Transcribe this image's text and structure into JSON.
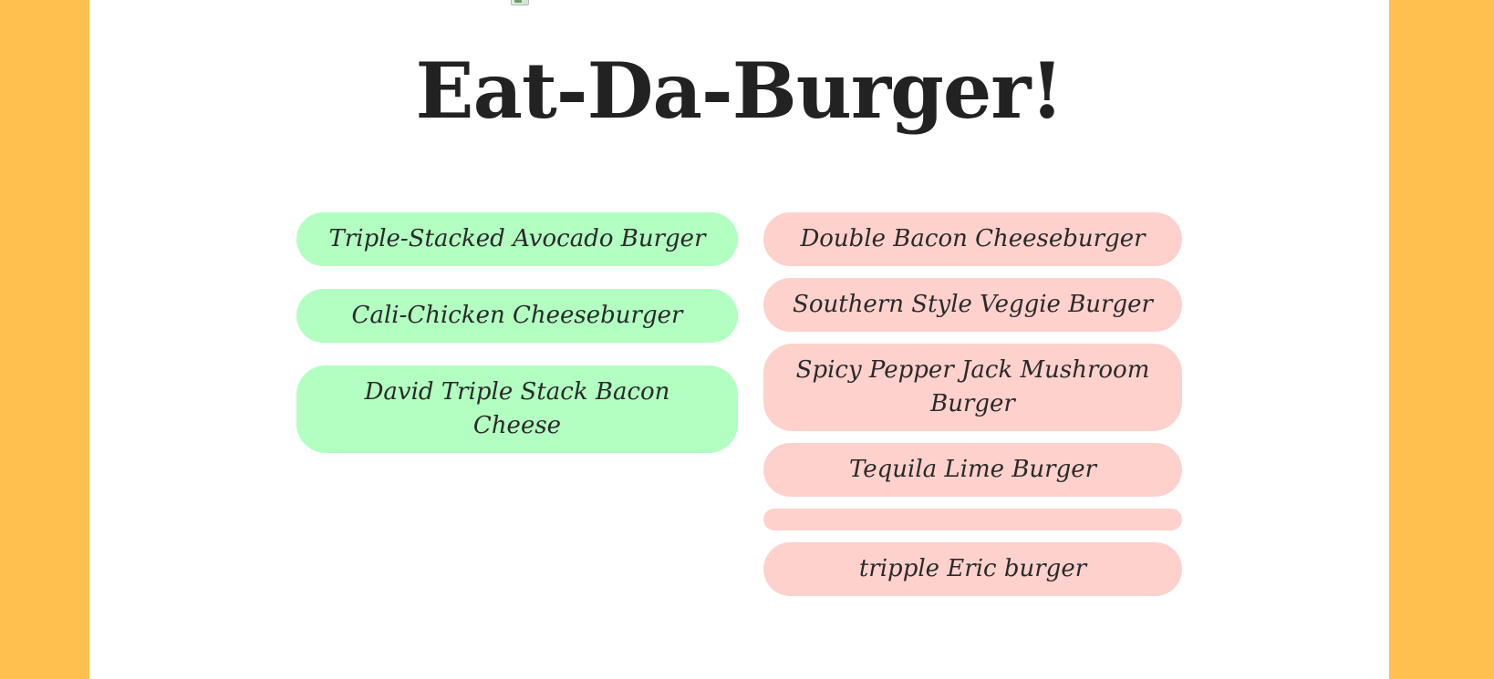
{
  "title": "Eat-Da-Burger!",
  "colors": {
    "background": "#ffc04e",
    "page": "#ffffff",
    "ready_button": "#b2ffc1",
    "devoured_button": "#ffd1cc",
    "text": "#222222"
  },
  "icons": {
    "header_image": "broken-image-icon"
  },
  "ready_burgers": [
    {
      "label": "Triple-Stacked Avocado Burger"
    },
    {
      "label": "Cali-Chicken Cheeseburger"
    },
    {
      "label": "David Triple Stack Bacon Cheese"
    }
  ],
  "devoured_burgers": [
    {
      "label": "Double Bacon Cheeseburger"
    },
    {
      "label": "Southern Style Veggie Burger"
    },
    {
      "label": "Spicy Pepper Jack Mushroom Burger"
    },
    {
      "label": "Tequila Lime Burger"
    },
    {
      "label": ""
    },
    {
      "label": "tripple Eric burger"
    }
  ]
}
